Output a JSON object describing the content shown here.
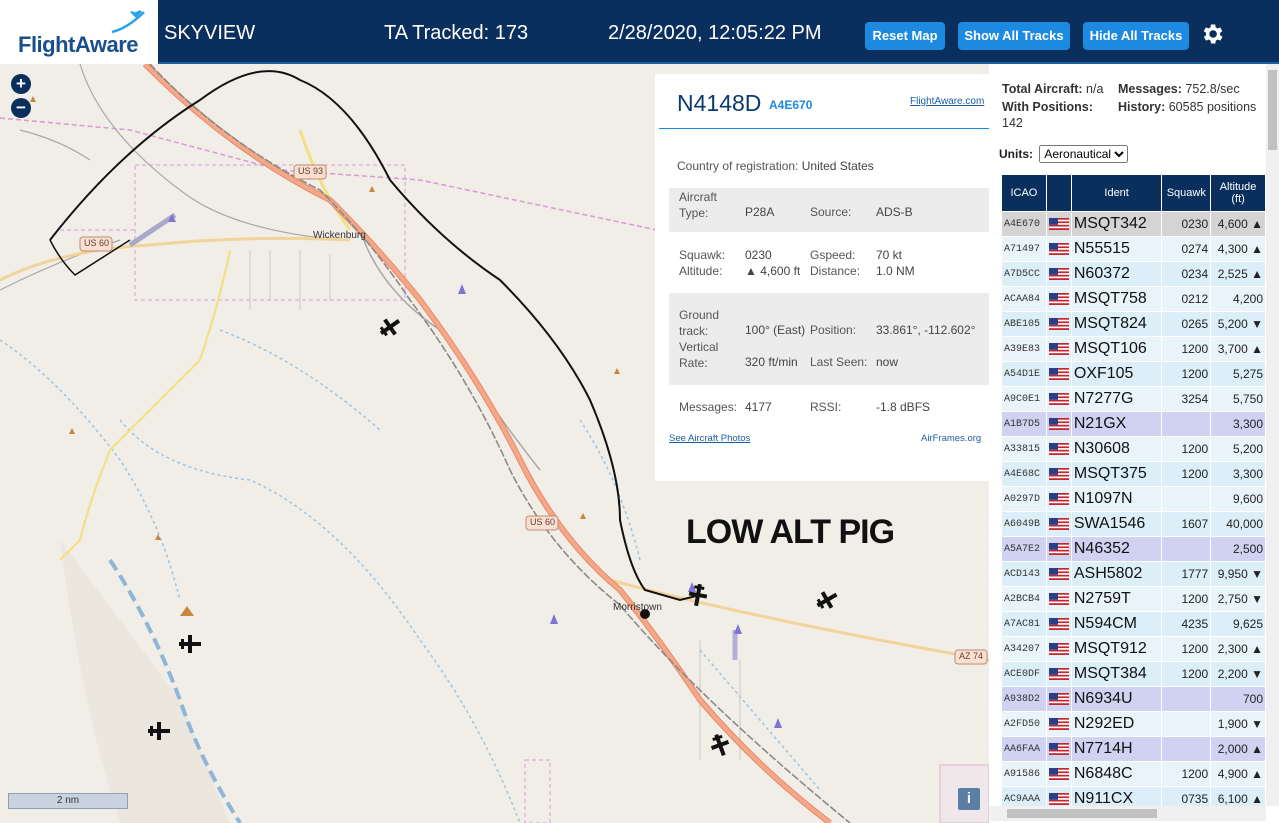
{
  "header": {
    "logo_text": "FlightAware",
    "app_name": "SKYVIEW",
    "tracked": "TA Tracked: 173",
    "datetime": "2/28/2020, 12:05:22 PM",
    "reset_label": "Reset Map",
    "show_label": "Show All Tracks",
    "hide_label": "Hide All Tracks",
    "settings_icon": "gear-icon"
  },
  "map": {
    "zoom_in": "+",
    "zoom_out": "−",
    "scale": "2 nm",
    "info": "i",
    "annotation": "LOW ALT PIG",
    "labels": {
      "us93": "US 93",
      "us60_left": "US 60",
      "us60_mid": "US 60",
      "az74": "AZ 74",
      "wickenburg": "Wickenburg",
      "morristown": "Morristown"
    },
    "colors": {
      "highway": "#f0a07a",
      "secondary": "#f3d79c",
      "track": "#000000"
    }
  },
  "infoblock": {
    "registration": "N4148D",
    "hex": "A4E670",
    "fa_link": "FlightAware.com",
    "country_label": "Country of registration:",
    "country": "United States",
    "aircraft_type_label": "Aircraft Type:",
    "aircraft_type": "P28A",
    "source_label": "Source:",
    "source": "ADS-B",
    "squawk_label": "Squawk:",
    "squawk": "0230",
    "gspeed_label": "Gspeed:",
    "gspeed": "70 kt",
    "altitude_label": "Altitude:",
    "altitude": "▲ 4,600 ft",
    "distance_label": "Distance:",
    "distance": "1.0 NM",
    "ground_track_label": "Ground track:",
    "ground_track": "100° (East)",
    "position_label": "Position:",
    "position": "33.861°, -112.602°",
    "vertical_rate_label": "Vertical Rate:",
    "vertical_rate": "320 ft/min",
    "last_seen_label": "Last Seen:",
    "last_seen": "now",
    "messages_label": "Messages:",
    "messages": "4177",
    "rssi_label": "RSSI:",
    "rssi": "-1.8 dBFS",
    "photos_link": "See Aircraft Photos",
    "airframes_link": "AirFrames.org"
  },
  "sidebar": {
    "total_label": "Total Aircraft:",
    "total": "n/a",
    "messages_label": "Messages:",
    "messages": "752.8/sec",
    "positions_label": "With Positions:",
    "positions": "142",
    "history_label": "History:",
    "history": "60585 positions",
    "units_label": "Units:",
    "units_value": "Aeronautical",
    "columns": [
      "ICAO",
      "",
      "Ident",
      "Squawk",
      "Altitude (ft)"
    ],
    "rows": [
      {
        "icao": "A4E670",
        "ident": "MSQT342",
        "squawk": "0230",
        "alt": "4,600 ▲",
        "style": "sel"
      },
      {
        "icao": "A71497",
        "ident": "N55515",
        "squawk": "0274",
        "alt": "4,300 ▲",
        "style": "even"
      },
      {
        "icao": "A7D5CC",
        "ident": "N60372",
        "squawk": "0234",
        "alt": "2,525 ▲",
        "style": "odd"
      },
      {
        "icao": "ACAA84",
        "ident": "MSQT758",
        "squawk": "0212",
        "alt": "4,200",
        "style": "even"
      },
      {
        "icao": "ABE105",
        "ident": "MSQT824",
        "squawk": "0265",
        "alt": "5,200 ▼",
        "style": "odd"
      },
      {
        "icao": "A39E83",
        "ident": "MSQT106",
        "squawk": "1200",
        "alt": "3,700 ▲",
        "style": "even"
      },
      {
        "icao": "A54D1E",
        "ident": "OXF105",
        "squawk": "1200",
        "alt": "5,275",
        "style": "odd"
      },
      {
        "icao": "A9C0E1",
        "ident": "N7277G",
        "squawk": "3254",
        "alt": "5,750",
        "style": "even"
      },
      {
        "icao": "A1B7D5",
        "ident": "N21GX",
        "squawk": "",
        "alt": "3,300",
        "style": "mlat"
      },
      {
        "icao": "A33815",
        "ident": "N30608",
        "squawk": "1200",
        "alt": "5,200",
        "style": "even"
      },
      {
        "icao": "A4E68C",
        "ident": "MSQT375",
        "squawk": "1200",
        "alt": "3,300",
        "style": "odd"
      },
      {
        "icao": "A0297D",
        "ident": "N1097N",
        "squawk": "",
        "alt": "9,600",
        "style": "even"
      },
      {
        "icao": "A6049B",
        "ident": "SWA1546",
        "squawk": "1607",
        "alt": "40,000",
        "style": "odd"
      },
      {
        "icao": "A5A7E2",
        "ident": "N46352",
        "squawk": "",
        "alt": "2,500",
        "style": "mlat"
      },
      {
        "icao": "ACD143",
        "ident": "ASH5802",
        "squawk": "1777",
        "alt": "9,950 ▼",
        "style": "odd"
      },
      {
        "icao": "A2BCB4",
        "ident": "N2759T",
        "squawk": "1200",
        "alt": "2,750 ▼",
        "style": "even"
      },
      {
        "icao": "A7AC81",
        "ident": "N594CM",
        "squawk": "4235",
        "alt": "9,625",
        "style": "odd"
      },
      {
        "icao": "A34207",
        "ident": "MSQT912",
        "squawk": "1200",
        "alt": "2,300 ▲",
        "style": "even"
      },
      {
        "icao": "ACE0DF",
        "ident": "MSQT384",
        "squawk": "1200",
        "alt": "2,200 ▼",
        "style": "odd"
      },
      {
        "icao": "A938D2",
        "ident": "N6934U",
        "squawk": "",
        "alt": "700",
        "style": "mlat"
      },
      {
        "icao": "A2FD50",
        "ident": "N292ED",
        "squawk": "",
        "alt": "1,900 ▼",
        "style": "even"
      },
      {
        "icao": "AA6FAA",
        "ident": "N7714H",
        "squawk": "",
        "alt": "2,000 ▲",
        "style": "mlat"
      },
      {
        "icao": "A91586",
        "ident": "N6848C",
        "squawk": "1200",
        "alt": "4,900 ▲",
        "style": "even"
      },
      {
        "icao": "AC9AAA",
        "ident": "N911CX",
        "squawk": "0735",
        "alt": "6,100 ▲",
        "style": "odd"
      }
    ]
  }
}
